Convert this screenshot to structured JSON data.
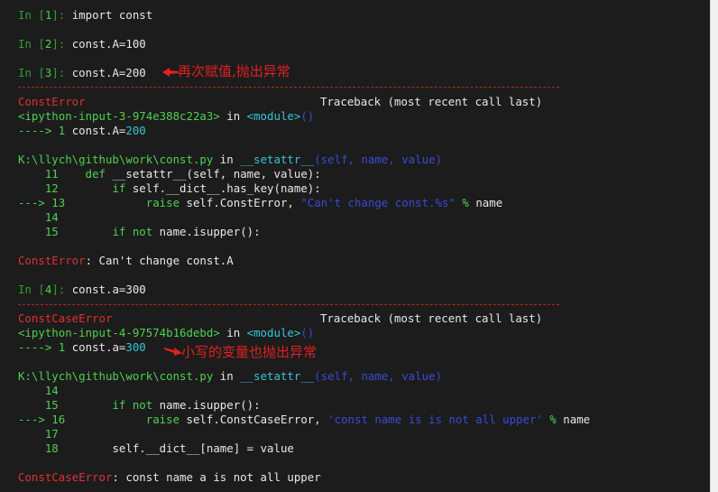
{
  "prompt_in": "In [",
  "prompt_out": "]:",
  "cells": [
    {
      "n": "1",
      "code": "import const"
    },
    {
      "n": "2",
      "code": "const.A=100"
    },
    {
      "n": "3",
      "code": "const.A=200"
    },
    {
      "n": "4",
      "code": "const.a=300"
    }
  ],
  "annotations": {
    "a1": "再次赋值,抛出异常",
    "a2": "小写的变量也抛出异常"
  },
  "tb1": {
    "err": "ConstError",
    "tb_header": "Traceback (most recent call last)",
    "input_ref": "<ipython-input-3-974e388c22a3>",
    "in": " in ",
    "module": "<module>",
    "paren": "()",
    "arrow": "----> 1 ",
    "code_pre": "const.A=",
    "code_val": "200",
    "file": "K:\\llych\\github\\work\\const.py",
    "func": "__setattr__",
    "args": "(self, name, value)",
    "f11": "11",
    "f11_kw": "def ",
    "f11_rest": "__setattr__(self, name, value):",
    "f12": "12",
    "f12_kw": "if ",
    "f12_rest": "self.__dict__.has_key(name):",
    "f13": "---> 13",
    "f13_kw": "raise ",
    "f13_mid": "self.ConstError, ",
    "f13_str": "\"Can't change const.%s\"",
    "f13_op": " % ",
    "f13_tail": "name",
    "f14": "14",
    "f15": "15",
    "f15_kw": "if not ",
    "f15_rest": "name.isupper():",
    "final_err": "ConstError",
    "final_msg": ": Can't change const.A"
  },
  "tb2": {
    "err": "ConstCaseError",
    "tb_header": "Traceback (most recent call last)",
    "input_ref": "<ipython-input-4-97574b16debd>",
    "in": " in ",
    "module": "<module>",
    "paren": "()",
    "arrow": "----> 1 ",
    "code_pre": "const.a=",
    "code_val": "300",
    "file": "K:\\llych\\github\\work\\const.py",
    "func": "__setattr__",
    "args": "(self, name, value)",
    "f14": "14",
    "f15": "15",
    "f15_kw": "if not ",
    "f15_rest": "name.isupper():",
    "f16": "---> 16",
    "f16_kw": "raise ",
    "f16_mid": "self.ConstCaseError, ",
    "f16_str": "'const name is is not all upper'",
    "f16_op": " % ",
    "f16_tail": "name",
    "f17": "17",
    "f18": "18",
    "f18_code": "self.__dict__[name] = value",
    "final_err": "ConstCaseError",
    "final_msg": ": const name a is not all upper"
  },
  "colors": {
    "background": "#1c1c1c",
    "prompt": "#2f9e2f",
    "error": "#e03030",
    "annotation": "#e02020"
  }
}
